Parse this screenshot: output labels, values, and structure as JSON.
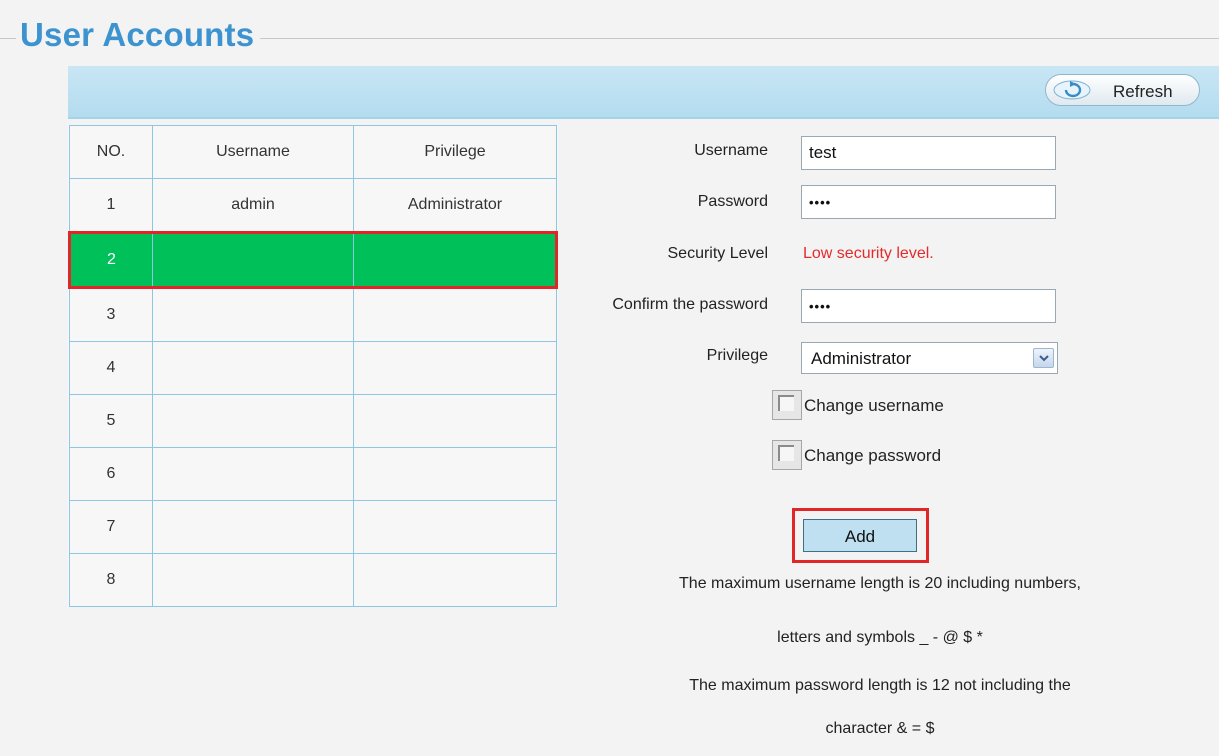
{
  "header": {
    "title": "User Accounts"
  },
  "toolbar": {
    "refresh_label": "Refresh"
  },
  "table": {
    "headers": [
      "NO.",
      "Username",
      "Privilege"
    ],
    "rows": [
      {
        "no": "1",
        "username": "admin",
        "privilege": "Administrator"
      },
      {
        "no": "2",
        "username": "",
        "privilege": ""
      },
      {
        "no": "3",
        "username": "",
        "privilege": ""
      },
      {
        "no": "4",
        "username": "",
        "privilege": ""
      },
      {
        "no": "5",
        "username": "",
        "privilege": ""
      },
      {
        "no": "6",
        "username": "",
        "privilege": ""
      },
      {
        "no": "7",
        "username": "",
        "privilege": ""
      },
      {
        "no": "8",
        "username": "",
        "privilege": ""
      }
    ],
    "selected_no": "2",
    "selected_color": "#00c05a"
  },
  "form": {
    "username_label": "Username",
    "username_value": "test",
    "password_label": "Password",
    "password_value": "••••",
    "security_label": "Security Level",
    "security_value": "Low security level.",
    "confirm_label": "Confirm the password",
    "confirm_value": "••••",
    "privilege_label": "Privilege",
    "privilege_value": "Administrator",
    "change_username_label": "Change username",
    "change_password_label": "Change password",
    "add_label": "Add"
  },
  "notes": {
    "line1": "The maximum username length is 20 including numbers,",
    "line2": "letters and symbols _ - @ $ *",
    "line3": "The maximum password length is 12 not including the",
    "line4": "character & = $"
  },
  "colors": {
    "title": "#3c93cf",
    "highlight_border": "#e02626",
    "warning_text": "#e42b2b"
  },
  "icons": {
    "refresh": "refresh-icon",
    "dropdown": "chevron-down-icon",
    "checkbox": "checkbox-icon"
  }
}
